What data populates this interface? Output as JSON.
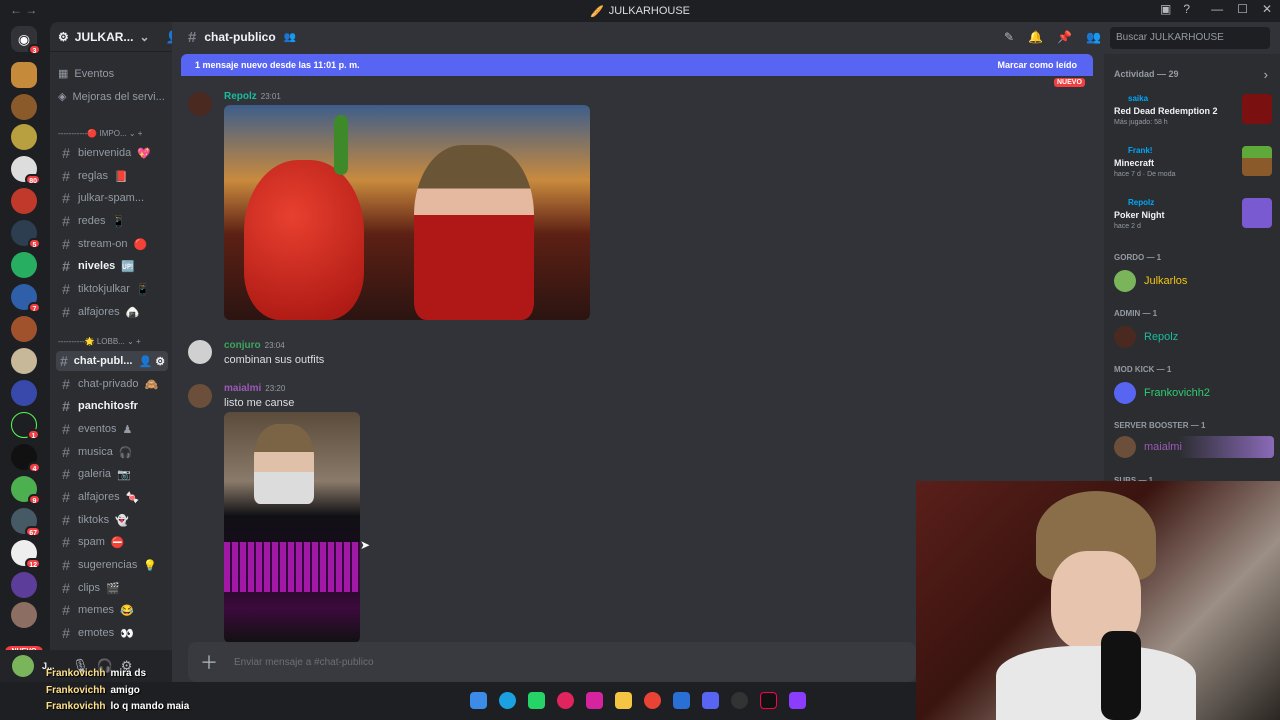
{
  "window": {
    "title": "JULKARHOUSE"
  },
  "server": {
    "name": "JULKAR...",
    "items": [
      "Eventos",
      "Mejoras del servi..."
    ]
  },
  "categories": [
    "IMPO...",
    "LOBB..."
  ],
  "channels_top": [
    {
      "name": "bienvenida",
      "emoji": "💖"
    },
    {
      "name": "reglas",
      "emoji": "📕"
    },
    {
      "name": "julkar-spam...",
      "emoji": ""
    },
    {
      "name": "redes",
      "emoji": "📱"
    },
    {
      "name": "stream-on",
      "emoji": "🔴"
    },
    {
      "name": "niveles",
      "emoji": "🆙"
    },
    {
      "name": "tiktokjulkar",
      "emoji": "📱"
    },
    {
      "name": "alfajores",
      "emoji": "🍙"
    }
  ],
  "channels_lobby": [
    {
      "name": "chat-publ...",
      "emoji": ""
    },
    {
      "name": "chat-privado",
      "emoji": "🙈"
    },
    {
      "name": "panchitosfr",
      "emoji": ""
    },
    {
      "name": "eventos",
      "emoji": "♟"
    },
    {
      "name": "musica",
      "emoji": "🎧"
    },
    {
      "name": "galeria",
      "emoji": "📷"
    },
    {
      "name": "alfajores",
      "emoji": "🍬"
    },
    {
      "name": "tiktoks",
      "emoji": "👻"
    },
    {
      "name": "spam",
      "emoji": "⛔"
    },
    {
      "name": "sugerencias",
      "emoji": "💡"
    },
    {
      "name": "clips",
      "emoji": "🎬"
    },
    {
      "name": "memes",
      "emoji": "😂"
    },
    {
      "name": "emotes",
      "emoji": "👀"
    }
  ],
  "server_badges": [
    "3",
    "80",
    "5",
    "7",
    "1",
    "4",
    "9",
    "67",
    "12"
  ],
  "server_new": "NUEVO",
  "channel_header": {
    "name": "chat-publico"
  },
  "search": {
    "placeholder": "Buscar JULKARHOUSE"
  },
  "banner": {
    "text": "1 mensaje nuevo desde las 11:01 p. m.",
    "action": "Marcar como leído",
    "new_tag": "NUEVO"
  },
  "messages": [
    {
      "user": "Repolz",
      "time": "23:01",
      "color": "#1abc9c",
      "text": ""
    },
    {
      "user": "conjuro",
      "time": "23:04",
      "color": "#1f8b4c",
      "text": "combinan sus outfits"
    },
    {
      "user": "maialmi",
      "time": "23:20",
      "color": "#9b59b6",
      "text": "listo me canse"
    }
  ],
  "composer": {
    "placeholder": "Enviar mensaje a #chat-publico"
  },
  "members": {
    "activity_header": "Actividad — 29",
    "activities": [
      {
        "who": "saika",
        "game": "Red Dead Redemption 2",
        "sub": "Más jugado: 58 h"
      },
      {
        "who": "Frank!",
        "game": "Minecraft",
        "sub": "hace 7 d  ·  De moda"
      },
      {
        "who": "Repolz",
        "game": "Poker Night",
        "sub": "hace 2 d"
      }
    ],
    "groups": [
      {
        "title": "GORDO — 1",
        "name": "Julkarlos",
        "color": "#f1c40f"
      },
      {
        "title": "ADMIN — 1",
        "name": "Repolz",
        "color": "#1abc9c"
      },
      {
        "title": "MOD KICK — 1",
        "name": "Frankovichh2",
        "color": "#2ecc71"
      },
      {
        "title": "SERVER BOOSTER — 1",
        "name": "maialmi",
        "color": "#9b59b6"
      },
      {
        "title": "SUBS — 1",
        "name": "",
        "color": "#949ba4"
      }
    ]
  },
  "stream_chat": [
    {
      "user": "Frankovichh",
      "text": "mira ds"
    },
    {
      "user": "Frankovichh",
      "text": "amigo"
    },
    {
      "user": "Frankovichh",
      "text": "lo q mando maia"
    }
  ],
  "user": {
    "name": "J..."
  }
}
